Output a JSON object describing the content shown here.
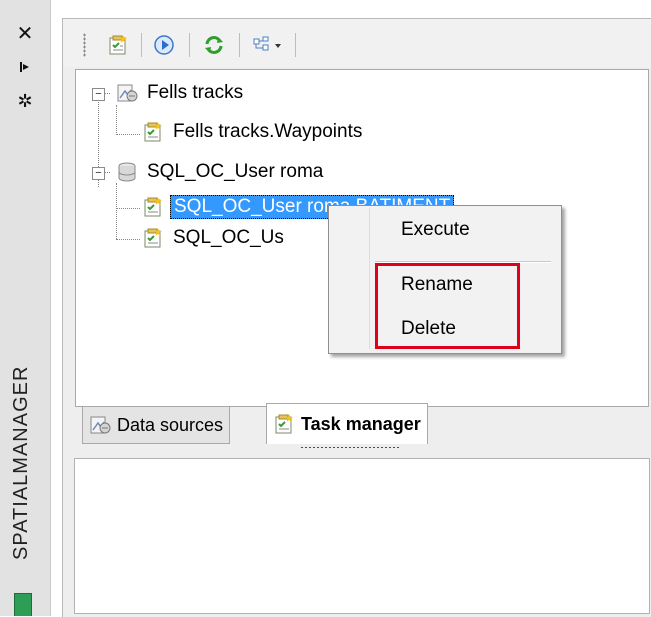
{
  "sidebar": {
    "title": "SPATIALMANAGER",
    "close_icon": "close-icon",
    "pin_icon": "pin-icon",
    "settings_icon": "gear-icon"
  },
  "toolbar": {
    "buttons": [
      "new-task-icon",
      "execute-icon",
      "refresh-icon",
      "tree-view-icon"
    ]
  },
  "tree": {
    "nodes": [
      {
        "label": "Fells tracks",
        "icon": "data-source-icon",
        "level": 0
      },
      {
        "label": "Fells tracks.Waypoints",
        "icon": "task-icon",
        "level": 1
      },
      {
        "label": "SQL_OC_User roma",
        "icon": "database-icon",
        "level": 0
      },
      {
        "label": "SQL_OC_User roma.BATIMENT",
        "icon": "task-icon",
        "level": 1,
        "selected": true
      },
      {
        "label": "SQL_OC_Us",
        "icon": "task-icon",
        "level": 1
      }
    ]
  },
  "context_menu": {
    "execute": "Execute",
    "rename": "Rename",
    "delete": "Delete"
  },
  "tabs": {
    "data_sources": "Data sources",
    "task_manager": "Task manager"
  },
  "colors": {
    "selection": "#3399ff",
    "highlight_border": "#e0001b"
  }
}
